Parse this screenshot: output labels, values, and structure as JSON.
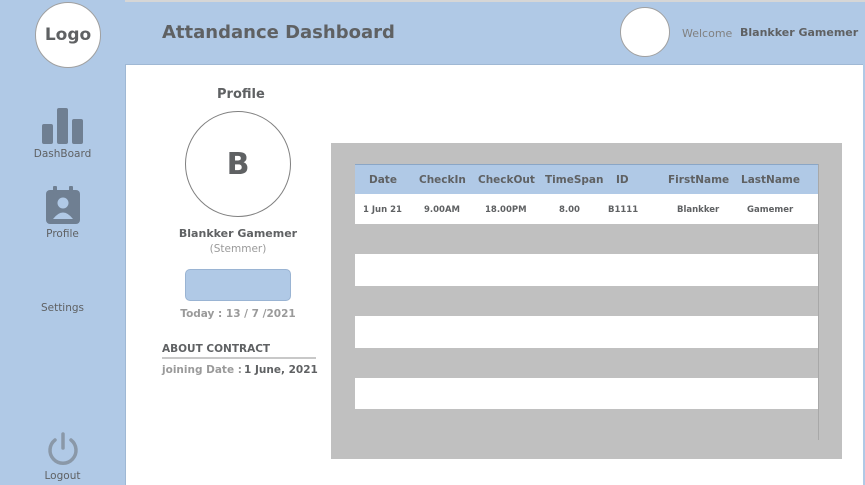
{
  "logo": {
    "text": "Logo"
  },
  "header": {
    "title": "Attandance Dashboard",
    "welcome_label": "Welcome",
    "user_name": "Blankker Gamemer"
  },
  "sidebar": {
    "items": [
      {
        "label": "DashBoard",
        "icon": "bar-chart-icon"
      },
      {
        "label": "Profile",
        "icon": "profile-card-icon"
      },
      {
        "label": "Settings",
        "icon": ""
      },
      {
        "label": "Logout",
        "icon": "power-icon"
      }
    ]
  },
  "profile": {
    "heading": "Profile",
    "initial": "B",
    "name": "Blankker Gamemer",
    "role": "(Stemmer)",
    "today": "Today : 13 / 7 /2021"
  },
  "contract": {
    "title": "ABOUT CONTRACT",
    "joining_label": "joining Date :",
    "joining_value": "1 June, 2021"
  },
  "table": {
    "columns": [
      "Date",
      "CheckIn",
      "CheckOut",
      "TimeSpan",
      "ID",
      "FirstName",
      "LastName"
    ],
    "rows": [
      [
        "1 Jun 21",
        "9.00AM",
        "18.00PM",
        "8.00",
        "B1111",
        "Blankker",
        "Gamemer"
      ]
    ]
  },
  "colors": {
    "sidebar_bg": "#b0c9e6",
    "table_panel_bg": "#c0c0c0",
    "text_dark": "#5f6163"
  }
}
